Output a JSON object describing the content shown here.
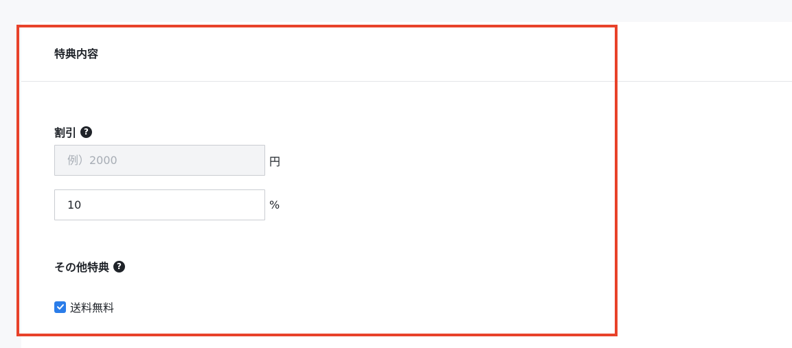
{
  "card": {
    "title": "特典内容"
  },
  "discount": {
    "label": "割引",
    "help_icon_glyph": "?",
    "yen_field": {
      "placeholder": "例）2000",
      "value": "",
      "unit": "円",
      "disabled": true
    },
    "percent_field": {
      "value": "10",
      "unit": "%"
    }
  },
  "other_benefits": {
    "label": "その他特典",
    "help_icon_glyph": "?",
    "checkbox": {
      "label": "送料無料",
      "checked": true
    }
  },
  "colors": {
    "highlight_border": "#e8422a",
    "checkbox_accent": "#2b7de9",
    "page_background": "#f7f8fa"
  },
  "icons": {
    "help": "question-circle-icon",
    "check": "checkmark-icon"
  }
}
